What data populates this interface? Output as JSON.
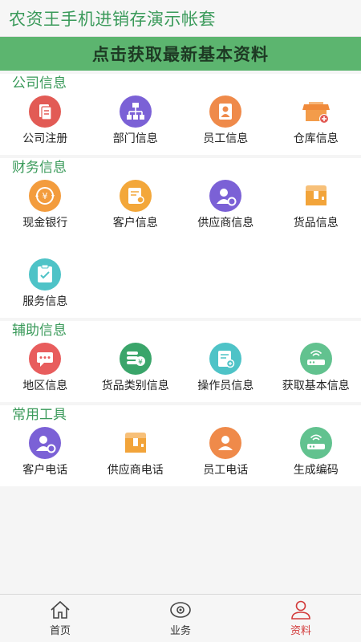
{
  "header": {
    "title": "农资王手机进销存演示帐套"
  },
  "banner": {
    "label": "点击获取最新基本资料"
  },
  "sections": [
    {
      "title": "公司信息",
      "items": [
        {
          "label": "公司注册",
          "icon": "document-icon",
          "color": "#e25b55"
        },
        {
          "label": "部门信息",
          "icon": "org-chart-icon",
          "color": "#7b61d6"
        },
        {
          "label": "员工信息",
          "icon": "person-icon",
          "color": "#ef8a4a"
        },
        {
          "label": "仓库信息",
          "icon": "warehouse-icon",
          "color": "#f08a3a"
        }
      ]
    },
    {
      "title": "财务信息",
      "items": [
        {
          "label": "现金银行",
          "icon": "money-cycle-icon",
          "color": "#f39c3d"
        },
        {
          "label": "客户信息",
          "icon": "customer-card-icon",
          "color": "#f3a73a"
        },
        {
          "label": "供应商信息",
          "icon": "supplier-user-icon",
          "color": "#7b61d6"
        },
        {
          "label": "货品信息",
          "icon": "goods-box-icon",
          "color": "#f2a43a"
        },
        {
          "label": "服务信息",
          "icon": "clipboard-check-icon",
          "color": "#4ec3c7"
        }
      ]
    },
    {
      "title": "辅助信息",
      "items": [
        {
          "label": "地区信息",
          "icon": "map-chat-icon",
          "color": "#e85d5d"
        },
        {
          "label": "货品类别信息",
          "icon": "coins-icon",
          "color": "#3aa56a"
        },
        {
          "label": "操作员信息",
          "icon": "operator-doc-icon",
          "color": "#4ec3c7"
        },
        {
          "label": "获取基本信息",
          "icon": "router-icon",
          "color": "#62c28f"
        }
      ]
    },
    {
      "title": "常用工具",
      "items": [
        {
          "label": "客户电话",
          "icon": "customer-gear-icon",
          "color": "#7b61d6"
        },
        {
          "label": "供应商电话",
          "icon": "supplier-box-icon",
          "color": "#f2a43a"
        },
        {
          "label": "员工电话",
          "icon": "person-icon",
          "color": "#ef8a4a"
        },
        {
          "label": "生成编码",
          "icon": "router-icon",
          "color": "#62c28f"
        }
      ]
    }
  ],
  "tabs": [
    {
      "label": "首页",
      "icon": "home-icon"
    },
    {
      "label": "业务",
      "icon": "eye-icon"
    },
    {
      "label": "资料",
      "icon": "profile-icon",
      "active": true
    }
  ],
  "colors": {
    "brand": "#5cb56f",
    "title_text": "#3a9a5a",
    "active_tab": "#d23a3a"
  }
}
